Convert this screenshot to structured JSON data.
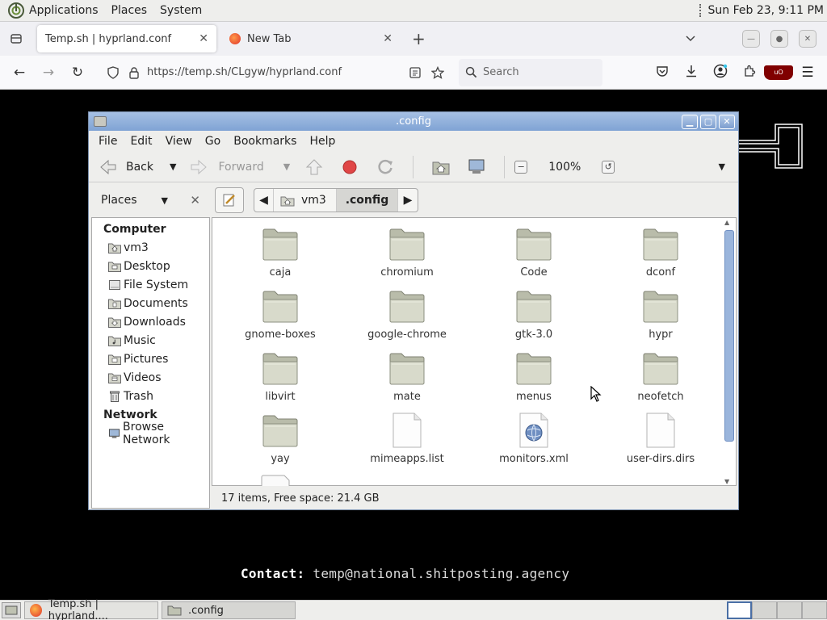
{
  "system_panel": {
    "menus": [
      "Applications",
      "Places",
      "System"
    ],
    "clock": "Sun Feb 23,  9:11 PM"
  },
  "browser": {
    "tabs": [
      {
        "title": "Temp.sh | hyprland.conf",
        "active": true
      },
      {
        "title": "New Tab",
        "active": false
      }
    ],
    "url": "https://temp.sh/CLgyw/hyprland.conf",
    "search_placeholder": "Search"
  },
  "page": {
    "contact_label": "Contact:",
    "contact_value": " temp@national.shitposting.agency"
  },
  "file_manager": {
    "title": ".config",
    "menu": [
      "File",
      "Edit",
      "View",
      "Go",
      "Bookmarks",
      "Help"
    ],
    "toolbar": {
      "back_label": "Back",
      "forward_label": "Forward",
      "zoom_level": "100%"
    },
    "places_label": "Places",
    "breadcrumb": [
      ".config",
      "vm3"
    ],
    "sidebar": {
      "computer_header": "Computer",
      "computer_items": [
        "vm3",
        "Desktop",
        "File System",
        "Documents",
        "Downloads",
        "Music",
        "Pictures",
        "Videos",
        "Trash"
      ],
      "network_header": "Network",
      "network_items": [
        "Browse Network"
      ]
    },
    "files": [
      {
        "name": "caja",
        "type": "folder"
      },
      {
        "name": "chromium",
        "type": "folder"
      },
      {
        "name": "Code",
        "type": "folder"
      },
      {
        "name": "dconf",
        "type": "folder"
      },
      {
        "name": "gnome-boxes",
        "type": "folder"
      },
      {
        "name": "google-chrome",
        "type": "folder"
      },
      {
        "name": "gtk-3.0",
        "type": "folder"
      },
      {
        "name": "hypr",
        "type": "folder"
      },
      {
        "name": "libvirt",
        "type": "folder"
      },
      {
        "name": "mate",
        "type": "folder"
      },
      {
        "name": "menus",
        "type": "folder"
      },
      {
        "name": "neofetch",
        "type": "folder"
      },
      {
        "name": "yay",
        "type": "folder"
      },
      {
        "name": "mimeapps.list",
        "type": "file"
      },
      {
        "name": "monitors.xml",
        "type": "xml"
      },
      {
        "name": "user-dirs.dirs",
        "type": "file"
      }
    ],
    "status": "17 items, Free space: 21.4 GB"
  },
  "taskbar": {
    "tasks": [
      "Temp.sh | hyprland....",
      ".config"
    ]
  }
}
